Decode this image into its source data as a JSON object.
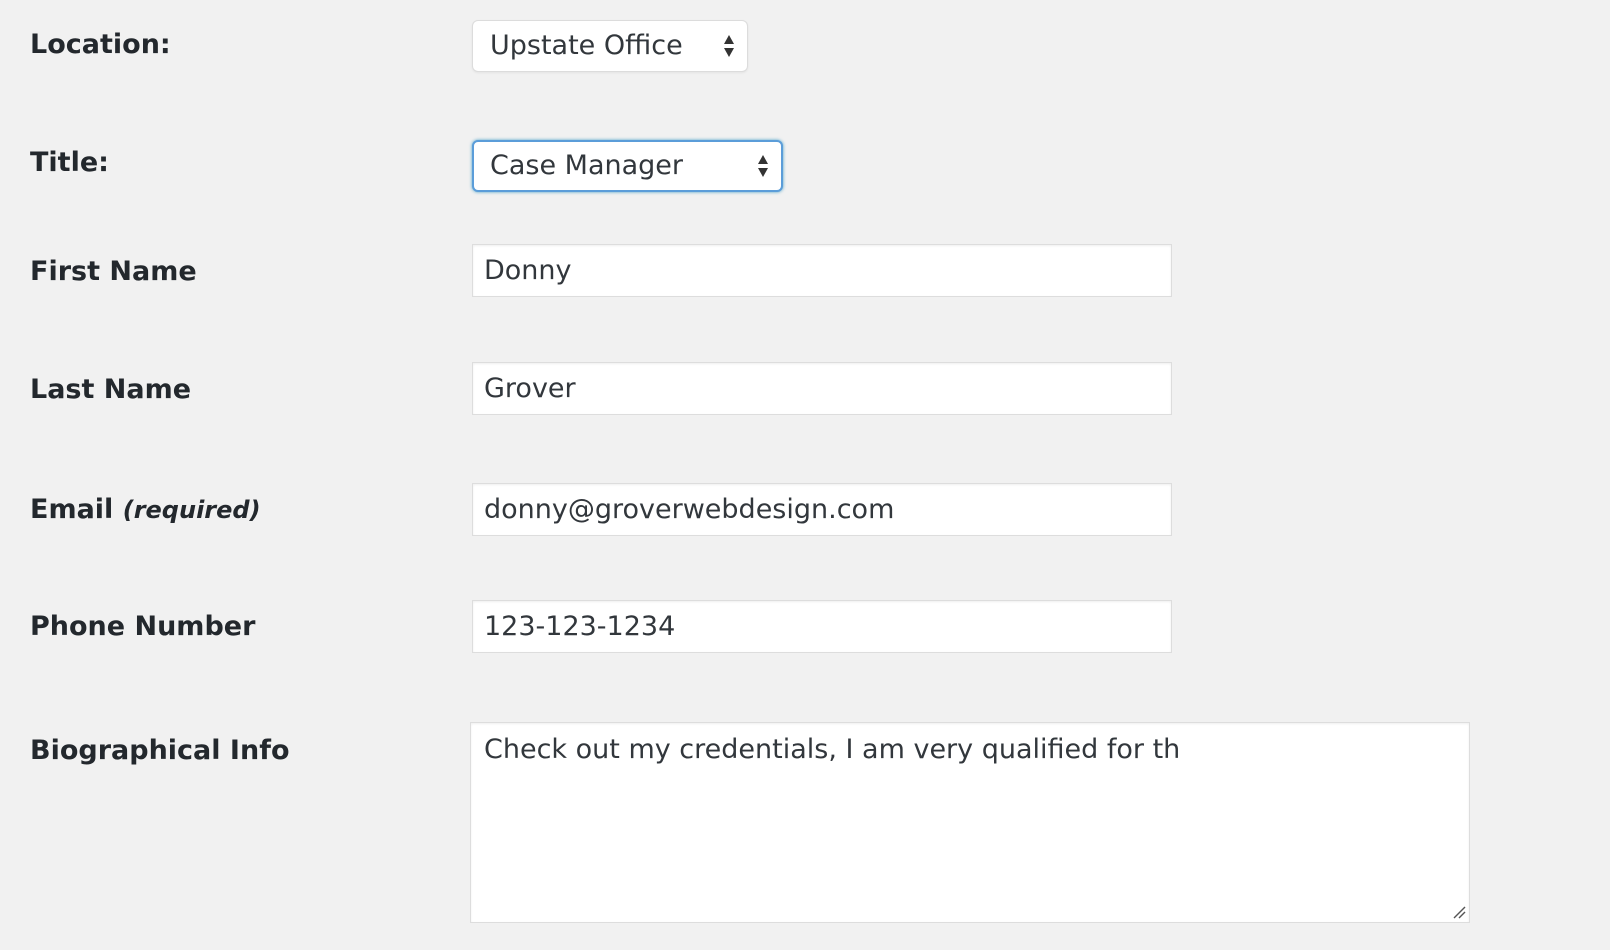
{
  "form": {
    "location": {
      "label": "Location:",
      "value": "Upstate Office"
    },
    "title": {
      "label": "Title:",
      "value": "Case Manager"
    },
    "first_name": {
      "label": "First Name",
      "value": "Donny"
    },
    "last_name": {
      "label": "Last Name",
      "value": "Grover"
    },
    "email": {
      "label": "Email",
      "required_note": "(required)",
      "value": "donny@groverwebdesign.com"
    },
    "phone": {
      "label": "Phone Number",
      "value": "123-123-1234"
    },
    "bio": {
      "label": "Biographical Info",
      "value": "Check out my credentials, I am very qualified for th"
    }
  },
  "icons": {
    "select_arrows": "up-down-arrows-icon",
    "resize_handle": "resize-handle-icon"
  },
  "colors": {
    "background": "#f1f1f1",
    "label_text": "#23282d",
    "field_text": "#32373c",
    "focus_border": "#5b9dd9",
    "field_border": "#dddddd"
  }
}
